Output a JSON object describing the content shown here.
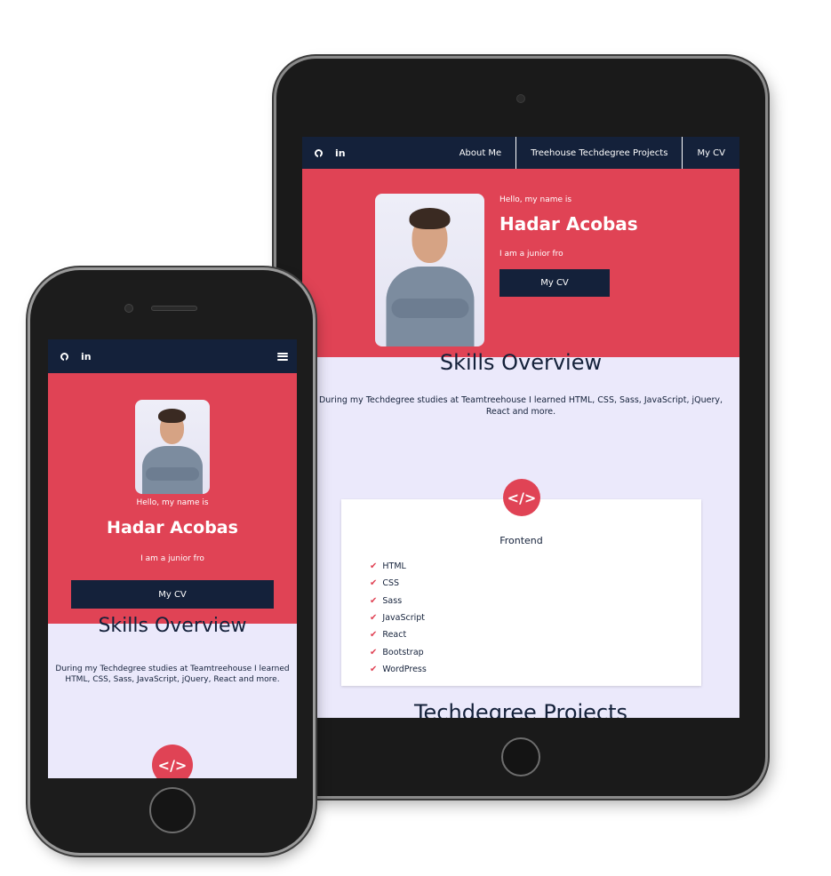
{
  "nav": {
    "github_icon": "github-icon",
    "linkedin_label": "in",
    "menu_items": [
      "About Me",
      "Treehouse Techdegree Projects",
      "My CV"
    ]
  },
  "hero": {
    "hello": "Hello, my name is",
    "name": "Hadar Acobas",
    "role": "I am a junior fro",
    "cv_button": "My CV"
  },
  "skills": {
    "title": "Skills Overview",
    "text": "During my Techdegree studies at Teamtreehouse I learned HTML, CSS, Sass, JavaScript, jQuery, React and more."
  },
  "frontend": {
    "icon": "</>",
    "title": "Frontend",
    "items": [
      "HTML",
      "CSS",
      "Sass",
      "JavaScript",
      "React",
      "Bootstrap",
      "WordPress"
    ]
  },
  "next_section": {
    "title": "Techdegree Projects"
  },
  "colors": {
    "navy": "#14213a",
    "accent": "#e04355",
    "background": "#ebe9fb"
  }
}
